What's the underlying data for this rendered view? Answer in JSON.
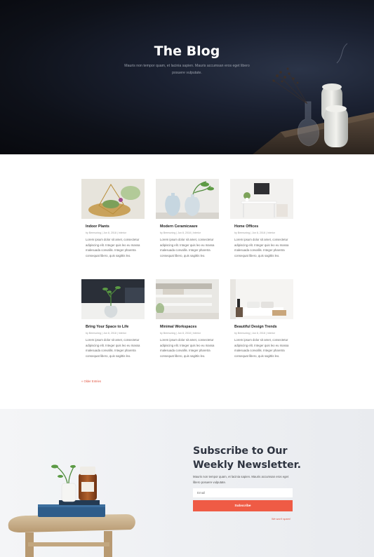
{
  "hero": {
    "title": "The Blog",
    "subtitle": "Mauris non tempor quam, et lacinia sapien. Mauris accumsan eros eget libero posuere vulputate."
  },
  "posts": [
    {
      "title": "Indoor Plants",
      "meta": "by Bermuning | Jun 8, 2018 | Interior",
      "excerpt": "Lorem ipsum dolor sit amet, consectetur adipiscing elit. Integer quis leo eu massa malesuada convallis. Integer pharetra consequat libero, quis sagittis leo.",
      "image": "plants-terrarium"
    },
    {
      "title": "Modern Ceramicware",
      "meta": "by Bermuning | Jun 8, 2018 | Interior",
      "excerpt": "Lorem ipsum dolor sit amet, consectetur adipiscing elit. Integer quis leo eu massa malesuada convallis. Integer pharetra consequat libero, quis sagittis leo.",
      "image": "ceramic-vases"
    },
    {
      "title": "Home Offices",
      "meta": "by Bermuning | Jun 8, 2018 | Interior",
      "excerpt": "Lorem ipsum dolor sit amet, consectetur adipiscing elit. Integer quis leo eu massa malesuada convallis. Integer pharetra consequat libero, quis sagittis leo.",
      "image": "home-office-desk"
    },
    {
      "title": "Bring Your Space to Life",
      "meta": "by Bermuning | Jun 8, 2018 | Interior",
      "excerpt": "Lorem ipsum dolor sit amet, consectetur adipiscing elit. Integer quis leo eu massa malesuada convallis. Integer pharetra consequat libero, quis sagittis leo.",
      "image": "plant-glass-vase"
    },
    {
      "title": "Minimal Workspaces",
      "meta": "by Bermuning | Jun 8, 2018 | Interior",
      "excerpt": "Lorem ipsum dolor sit amet, consectetur adipiscing elit. Integer quis leo eu massa malesuada convallis. Integer pharetra consequat libero, quis sagittis leo.",
      "image": "minimal-shelves"
    },
    {
      "title": "Beautiful Design Trends",
      "meta": "by Bermuning | Jun 8, 2018 | Interior",
      "excerpt": "Lorem ipsum dolor sit amet, consectetur adipiscing elit. Integer quis leo eu massa malesuada convallis. Integer pharetra consequat libero, quis sagittis leo.",
      "image": "bedroom"
    }
  ],
  "pagination": {
    "older_label": "« Older Entries"
  },
  "newsletter": {
    "title_line1": "Subscribe to Our",
    "title_line2": "Weekly Newsletter.",
    "text": "Mauris non tempor quam, et lacinia sapien. Mauris accumsan eros eget libero posuere vulputate.",
    "email_placeholder": "Email",
    "button_label": "Subscribe",
    "spam_note": "We won't spam!"
  },
  "colors": {
    "accent": "#ef5b45",
    "hero_bg": "#0e1119",
    "newsletter_bg": "#eef0f3"
  }
}
